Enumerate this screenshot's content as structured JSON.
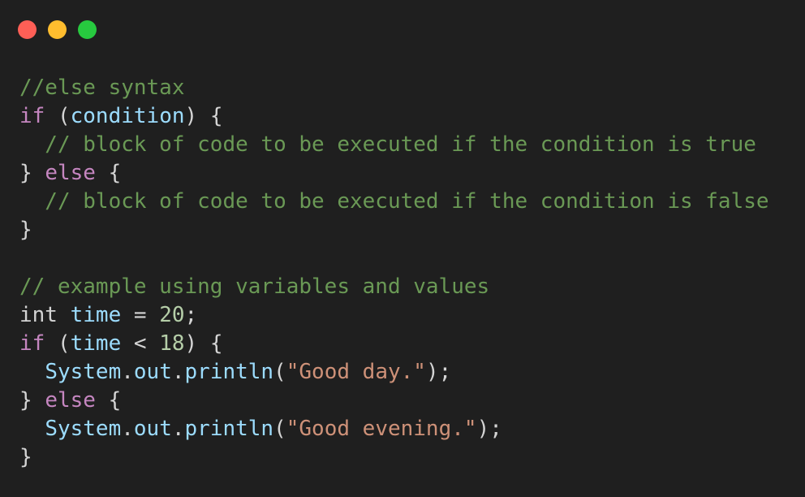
{
  "window": {
    "traffic_lights": [
      {
        "name": "close",
        "color": "#ff5f56"
      },
      {
        "name": "minimize",
        "color": "#ffbd2e"
      },
      {
        "name": "zoom",
        "color": "#27c93f"
      }
    ]
  },
  "colors": {
    "background": "#1f1f1f",
    "comment": "#6a9955",
    "keyword": "#c586c0",
    "variable": "#9cdcfe",
    "number": "#b5cea8",
    "string": "#ce9178",
    "plain": "#d4d4d4"
  },
  "code": {
    "lines": [
      [
        {
          "t": "//else syntax",
          "k": "comment"
        }
      ],
      [
        {
          "t": "if",
          "k": "keyword"
        },
        {
          "t": " (",
          "k": "punct"
        },
        {
          "t": "condition",
          "k": "var"
        },
        {
          "t": ") {",
          "k": "punct"
        }
      ],
      [
        {
          "t": "  // block of code to be executed if the condition is true",
          "k": "comment"
        }
      ],
      [
        {
          "t": "} ",
          "k": "punct"
        },
        {
          "t": "else",
          "k": "keyword"
        },
        {
          "t": " {",
          "k": "punct"
        }
      ],
      [
        {
          "t": "  // block of code to be executed if the condition is false",
          "k": "comment"
        }
      ],
      [
        {
          "t": "}",
          "k": "punct"
        }
      ],
      [],
      [
        {
          "t": "// example using variables and values",
          "k": "comment"
        }
      ],
      [
        {
          "t": "int",
          "k": "type"
        },
        {
          "t": " ",
          "k": "plain"
        },
        {
          "t": "time",
          "k": "var"
        },
        {
          "t": " = ",
          "k": "punct"
        },
        {
          "t": "20",
          "k": "number"
        },
        {
          "t": ";",
          "k": "punct"
        }
      ],
      [
        {
          "t": "if",
          "k": "keyword"
        },
        {
          "t": " (",
          "k": "punct"
        },
        {
          "t": "time",
          "k": "var"
        },
        {
          "t": " < ",
          "k": "punct"
        },
        {
          "t": "18",
          "k": "number"
        },
        {
          "t": ") {",
          "k": "punct"
        }
      ],
      [
        {
          "t": "  ",
          "k": "plain"
        },
        {
          "t": "System",
          "k": "var"
        },
        {
          "t": ".",
          "k": "punct"
        },
        {
          "t": "out",
          "k": "var"
        },
        {
          "t": ".",
          "k": "punct"
        },
        {
          "t": "println",
          "k": "func"
        },
        {
          "t": "(",
          "k": "punct"
        },
        {
          "t": "\"Good day.\"",
          "k": "string"
        },
        {
          "t": ");",
          "k": "punct"
        }
      ],
      [
        {
          "t": "} ",
          "k": "punct"
        },
        {
          "t": "else",
          "k": "keyword"
        },
        {
          "t": " {",
          "k": "punct"
        }
      ],
      [
        {
          "t": "  ",
          "k": "plain"
        },
        {
          "t": "System",
          "k": "var"
        },
        {
          "t": ".",
          "k": "punct"
        },
        {
          "t": "out",
          "k": "var"
        },
        {
          "t": ".",
          "k": "punct"
        },
        {
          "t": "println",
          "k": "func"
        },
        {
          "t": "(",
          "k": "punct"
        },
        {
          "t": "\"Good evening.\"",
          "k": "string"
        },
        {
          "t": ");",
          "k": "punct"
        }
      ],
      [
        {
          "t": "}",
          "k": "punct"
        }
      ]
    ]
  }
}
